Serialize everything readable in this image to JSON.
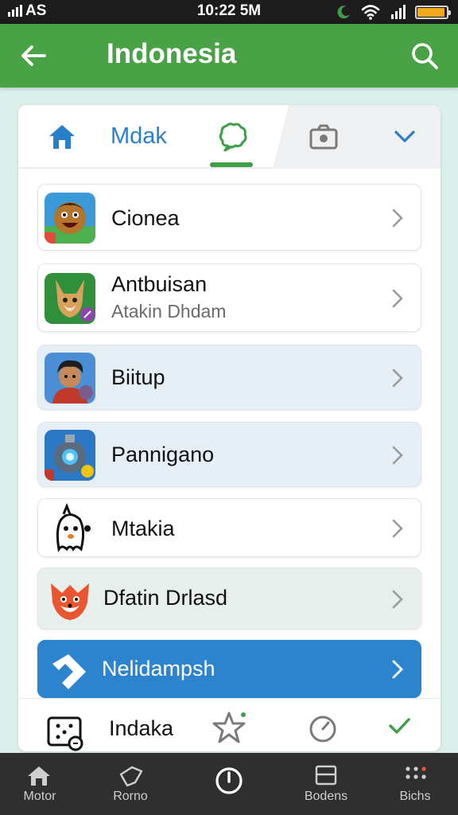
{
  "status_bar": {
    "carrier": "AS",
    "time": "10:22 5M",
    "battery_level": 0.95,
    "battery_color": "#f4a81e"
  },
  "app_bar": {
    "title": "Indonesia",
    "back_icon": "arrow-left-icon",
    "search_icon": "search-icon",
    "color": "#4aa247"
  },
  "tabs": {
    "home_icon": "home-icon",
    "label": "Mdak",
    "chat_icon": "chat-bubble-icon",
    "camera_icon": "camera-icon",
    "more_icon": "chevron-down-icon",
    "selected": "chat-bubble-icon",
    "accent": "#3e9f47"
  },
  "list": [
    {
      "label": "Cionea",
      "subtitle": "",
      "icon": "cartoon-face-app-icon"
    },
    {
      "label": "Antbuisan",
      "subtitle": "Atakin Dhdam",
      "icon": "fox-app-icon"
    },
    {
      "label": "Biitup",
      "subtitle": "",
      "icon": "avatar-app-icon"
    },
    {
      "label": "Pannigano",
      "subtitle": "",
      "icon": "robot-app-icon"
    },
    {
      "label": "Mtakia",
      "subtitle": "",
      "icon": "ghost-app-icon"
    },
    {
      "label": "Dfatin Drlasd",
      "subtitle": "",
      "icon": "fox-mascot-app-icon"
    },
    {
      "label": "Nelidampsh",
      "subtitle": "",
      "icon": "direction-arrow-icon",
      "active": true
    }
  ],
  "panel_footer": {
    "label": "Indaka",
    "icon": "dice-app-icon",
    "star_icon": "star-icon",
    "timer_icon": "timer-icon",
    "check_icon": "check-icon"
  },
  "bottom_nav": [
    {
      "label": "Motor",
      "icon": "home-icon"
    },
    {
      "label": "Rorno",
      "icon": "heart-icon"
    },
    {
      "label": "",
      "icon": "power-icon"
    },
    {
      "label": "Bodens",
      "icon": "window-icon"
    },
    {
      "label": "Bichs",
      "icon": "grid-dots-icon"
    }
  ]
}
